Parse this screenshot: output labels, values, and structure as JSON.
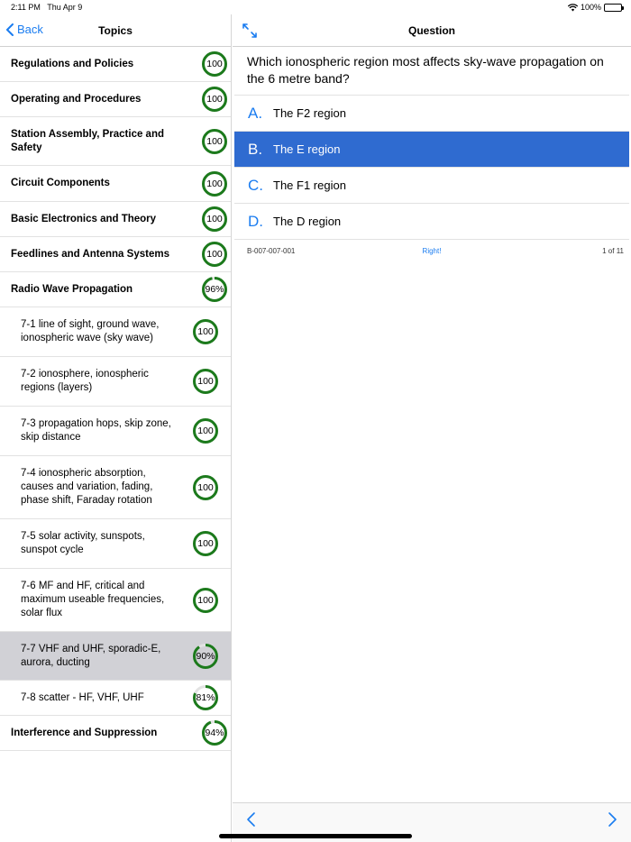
{
  "status": {
    "time": "2:11 PM",
    "date": "Thu Apr 9",
    "battery": "100%"
  },
  "left": {
    "back_label": "Back",
    "title": "Topics",
    "rows": [
      {
        "label": "Regulations and Policies",
        "score": "100",
        "level": 1.0,
        "kind": "top"
      },
      {
        "label": "Operating and Procedures",
        "score": "100",
        "level": 1.0,
        "kind": "top"
      },
      {
        "label": "Station Assembly, Practice and Safety",
        "score": "100",
        "level": 1.0,
        "kind": "top"
      },
      {
        "label": "Circuit Components",
        "score": "100",
        "level": 1.0,
        "kind": "top"
      },
      {
        "label": "Basic Electronics and Theory",
        "score": "100",
        "level": 1.0,
        "kind": "top"
      },
      {
        "label": "Feedlines and Antenna Systems",
        "score": "100",
        "level": 1.0,
        "kind": "top"
      },
      {
        "label": "Radio Wave Propagation",
        "score": "96%",
        "level": 0.96,
        "kind": "top"
      },
      {
        "label": "7-1 line of sight, ground wave, ionospheric wave (sky wave)",
        "score": "100",
        "level": 1.0,
        "kind": "sub"
      },
      {
        "label": "7-2 ionosphere, ionospheric regions (layers)",
        "score": "100",
        "level": 1.0,
        "kind": "sub"
      },
      {
        "label": "7-3 propagation hops, skip zone, skip distance",
        "score": "100",
        "level": 1.0,
        "kind": "sub"
      },
      {
        "label": "7-4 ionospheric absorption, causes and variation, fading, phase shift, Faraday rotation",
        "score": "100",
        "level": 1.0,
        "kind": "sub"
      },
      {
        "label": "7-5 solar activity, sunspots, sunspot cycle",
        "score": "100",
        "level": 1.0,
        "kind": "sub"
      },
      {
        "label": "7-6 MF and HF, critical and maximum useable frequencies, solar flux",
        "score": "100",
        "level": 1.0,
        "kind": "sub"
      },
      {
        "label": "7-7 VHF and UHF, sporadic-E, aurora, ducting",
        "score": "90%",
        "level": 0.9,
        "kind": "sub",
        "selected": true
      },
      {
        "label": "7-8 scatter - HF, VHF, UHF",
        "score": "81%",
        "level": 0.81,
        "kind": "sub"
      },
      {
        "label": "Interference and Suppression",
        "score": "94%",
        "level": 0.94,
        "kind": "top"
      }
    ]
  },
  "question": {
    "title": "Question",
    "text": "Which ionospheric region most affects sky-wave propagation on the 6 metre band?",
    "answers": [
      {
        "letter": "A.",
        "text": "The F2 region"
      },
      {
        "letter": "B.",
        "text": "The E region",
        "selected": true
      },
      {
        "letter": "C.",
        "text": "The F1 region"
      },
      {
        "letter": "D.",
        "text": "The D region"
      }
    ],
    "id": "B-007-007-001",
    "result": "Right!",
    "count": "1 of 11"
  },
  "colors": {
    "accent": "#1a7cf0",
    "ring_done": "#1c7a1c",
    "selected_answer": "#2f6bd0",
    "selected_row": "#d1d1d6"
  }
}
